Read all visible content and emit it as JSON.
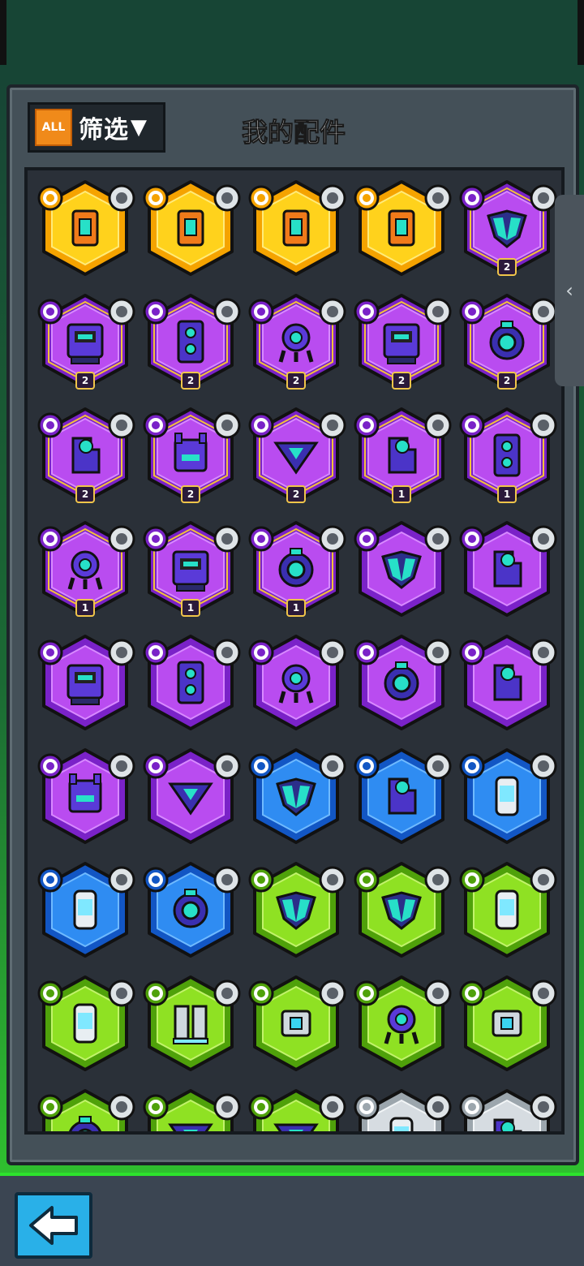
{
  "header": {
    "title": "我的配件"
  },
  "filter": {
    "all_label": "ALL",
    "label": "筛选",
    "arrow": "▼"
  },
  "colors": {
    "gold": [
      "#ffd21c",
      "#f5a300",
      "#ffeb7a"
    ],
    "purple": [
      "#b94cf0",
      "#7a22c8",
      "#d889ff"
    ],
    "blue": [
      "#2f8cf2",
      "#1256c4",
      "#6fbaff"
    ],
    "green": [
      "#8fe123",
      "#4fa10a",
      "#c2f36b"
    ],
    "silver": [
      "#d6dce1",
      "#9ca6ad",
      "#f2f5f7"
    ]
  },
  "parts": [
    {
      "rarity": "gold",
      "role": "shield-icon",
      "icon": "battery-block-icon",
      "tag": "gear-tag-icon",
      "level": null
    },
    {
      "rarity": "gold",
      "role": "shield-icon",
      "icon": "clamp-block-icon",
      "tag": "sawblade-tag-icon",
      "level": null
    },
    {
      "rarity": "gold",
      "role": "attack-icon",
      "icon": "ring-turret-icon",
      "tag": "drill-tag-icon",
      "level": null
    },
    {
      "rarity": "gold",
      "role": "attack-icon",
      "icon": "orb-turret-icon",
      "tag": "tape-tag-icon",
      "level": null
    },
    {
      "rarity": "purple",
      "role": "shield-icon",
      "icon": "crystal-shield-icon",
      "tag": "rocket-tag-icon",
      "level": "2"
    },
    {
      "rarity": "purple",
      "role": "shield-icon",
      "icon": "monitor-block-icon",
      "tag": "brick-tag-icon",
      "level": "2"
    },
    {
      "rarity": "purple",
      "role": "shield-icon",
      "icon": "speaker-block-icon",
      "tag": "arc-tag-icon",
      "level": "2"
    },
    {
      "rarity": "purple",
      "role": "shield-icon",
      "icon": "walker-pod-icon",
      "tag": "spiky-ball-tag-icon",
      "level": "2"
    },
    {
      "rarity": "purple",
      "role": "attack-icon",
      "icon": "cabinet-block-icon",
      "tag": "cone-tag-icon",
      "level": "2"
    },
    {
      "rarity": "purple",
      "role": "attack-icon",
      "icon": "eye-turret-icon",
      "tag": "soccer-ball-tag-icon",
      "level": "2"
    },
    {
      "rarity": "purple",
      "role": "attack-icon",
      "icon": "cannon-block-icon",
      "tag": "tape-tag-icon",
      "level": "2"
    },
    {
      "rarity": "purple",
      "role": "attack-icon",
      "icon": "horn-block-icon",
      "tag": "box-tag-icon",
      "level": "2"
    },
    {
      "rarity": "purple",
      "role": "attack-icon",
      "icon": "triangle-core-icon",
      "tag": "bottle-tag-icon",
      "level": "2"
    },
    {
      "rarity": "purple",
      "role": "shield-icon",
      "icon": "step-block-icon",
      "tag": "sawblade-tag-icon",
      "level": "1"
    },
    {
      "rarity": "purple",
      "role": "shield-icon",
      "icon": "speaker-block-icon",
      "tag": "arc-tag-icon",
      "level": "1"
    },
    {
      "rarity": "purple",
      "role": "shield-icon",
      "icon": "walker-pod-icon",
      "tag": "spiky-ball-tag-icon",
      "level": "1"
    },
    {
      "rarity": "purple",
      "role": "attack-icon",
      "icon": "cabinet-block-icon",
      "tag": "cone-tag-icon",
      "level": "1"
    },
    {
      "rarity": "purple",
      "role": "attack-icon",
      "icon": "eye-turret-icon",
      "tag": "soccer-ball-tag-icon",
      "level": "1"
    },
    {
      "rarity": "purple",
      "role": "shield-icon",
      "icon": "crystal-shield-icon",
      "tag": "rocket-tag-icon",
      "level": null
    },
    {
      "rarity": "purple",
      "role": "shield-icon",
      "icon": "step-block-icon",
      "tag": "sawblade-tag-icon",
      "level": null
    },
    {
      "rarity": "purple",
      "role": "shield-icon",
      "icon": "monitor-block-icon",
      "tag": "brick-tag-icon",
      "level": null
    },
    {
      "rarity": "purple",
      "role": "shield-icon",
      "icon": "speaker-block-icon",
      "tag": "arc-tag-icon",
      "level": null
    },
    {
      "rarity": "purple",
      "role": "shield-icon",
      "icon": "walker-pod-icon",
      "tag": "spiky-ball-tag-icon",
      "level": null
    },
    {
      "rarity": "purple",
      "role": "attack-icon",
      "icon": "eye-turret-icon",
      "tag": "soccer-ball-tag-icon",
      "level": null
    },
    {
      "rarity": "purple",
      "role": "attack-icon",
      "icon": "cannon-block-icon",
      "tag": "tape-tag-icon",
      "level": null
    },
    {
      "rarity": "purple",
      "role": "attack-icon",
      "icon": "horn-block-icon",
      "tag": "box-tag-icon",
      "level": null
    },
    {
      "rarity": "purple",
      "role": "attack-icon",
      "icon": "triangle-core-icon",
      "tag": "bottle-tag-icon",
      "level": null
    },
    {
      "rarity": "blue",
      "role": "shield-icon",
      "icon": "crystal-shield-icon",
      "tag": "knife-tag-icon",
      "level": null
    },
    {
      "rarity": "blue",
      "role": "shield-icon",
      "icon": "step-block-icon",
      "tag": "sawblade-tag-icon",
      "level": null
    },
    {
      "rarity": "blue",
      "role": "attack-icon",
      "icon": "capsule-block-icon",
      "tag": "spring-tag-icon",
      "level": null
    },
    {
      "rarity": "blue",
      "role": "attack-icon",
      "icon": "capsule-block-icon",
      "tag": "spring-tag-icon",
      "level": null
    },
    {
      "rarity": "blue",
      "role": "attack-icon",
      "icon": "ring-core-icon",
      "tag": "soccer-ball-tag-icon",
      "level": null
    },
    {
      "rarity": "green",
      "role": "shield-icon",
      "icon": "crystal-shield-icon",
      "tag": "knife-tag-icon",
      "level": null
    },
    {
      "rarity": "green",
      "role": "shield-icon",
      "icon": "crystal-shield-icon",
      "tag": "knife-tag-icon",
      "level": null
    },
    {
      "rarity": "green",
      "role": "shield-icon",
      "icon": "cylinder-block-icon",
      "tag": "star-tag-icon",
      "level": null
    },
    {
      "rarity": "green",
      "role": "shield-icon",
      "icon": "cylinder-block-icon",
      "tag": "star-tag-icon",
      "level": null
    },
    {
      "rarity": "green",
      "role": "shield-icon",
      "icon": "twin-block-icon",
      "tag": "plate-tag-icon",
      "level": null
    },
    {
      "rarity": "green",
      "role": "shield-icon",
      "icon": "camera-block-icon",
      "tag": "helmet-tag-icon",
      "level": null
    },
    {
      "rarity": "green",
      "role": "shield-icon",
      "icon": "eye-walker-icon",
      "tag": "spiky-ball-tag-icon",
      "level": null
    },
    {
      "rarity": "green",
      "role": "attack-icon",
      "icon": "flat-turret-icon",
      "tag": "shell-tag-icon",
      "level": null
    },
    {
      "rarity": "green",
      "role": "attack-icon",
      "icon": "eye-turret-icon",
      "tag": "shell-tag-icon",
      "level": null
    },
    {
      "rarity": "green",
      "role": "attack-icon",
      "icon": "triangle-core-icon",
      "tag": "bottle-tag-icon",
      "level": null
    },
    {
      "rarity": "green",
      "role": "attack-icon",
      "icon": "triangle-core-icon",
      "tag": "knife-tag-icon",
      "level": null
    },
    {
      "rarity": "silver",
      "role": "shield-icon",
      "icon": "cylinder-block-icon",
      "tag": "star-tag-icon",
      "level": null
    },
    {
      "rarity": "silver",
      "role": "shield-icon",
      "icon": "step-block-icon",
      "tag": "sawblade-tag-icon",
      "level": null
    }
  ],
  "side_tab": {
    "arrow": "‹"
  }
}
